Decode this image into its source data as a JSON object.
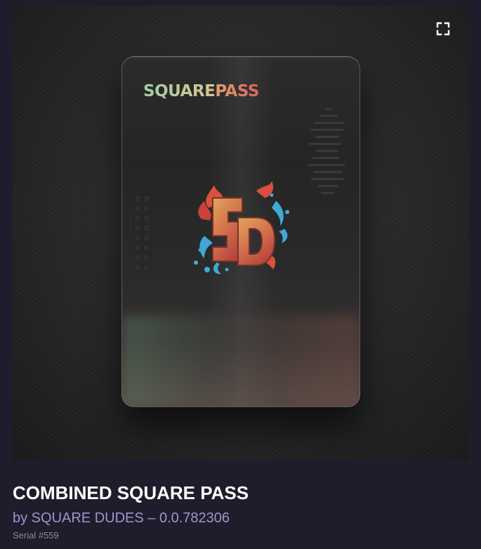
{
  "media": {
    "expand_icon": "expand-corners-icon",
    "card": {
      "wordmark_part1": "SQUARE",
      "wordmark_part2": "PASS",
      "monogram": "SD"
    }
  },
  "nft": {
    "title": "COMBINED SQUARE PASS",
    "byline": "by SQUARE DUDES – 0.0.782306",
    "serial": "Serial #559"
  },
  "colors": {
    "page_bg": "#1f1d2b",
    "byline": "#9b97cf",
    "serial": "#8b879b",
    "title": "#ffffff"
  }
}
